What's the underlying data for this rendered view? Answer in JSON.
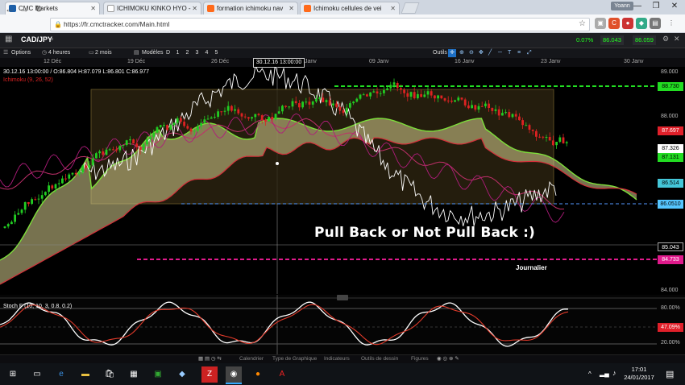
{
  "browser": {
    "tabs": [
      {
        "title": "CMC Markets",
        "color": "#1d5fa8"
      },
      {
        "title": "ICHIMOKU KINKO HYO - ",
        "color": "#888888"
      },
      {
        "title": "formation ichimoku nav",
        "color": "#ff6a1a"
      },
      {
        "title": "Ichimoku cellules de vei",
        "color": "#ff6a1a"
      }
    ],
    "user": "Yoann",
    "url": "https://fr.cmctracker.com/Main.html",
    "window_buttons": [
      "—",
      "❐",
      "✕"
    ]
  },
  "app": {
    "symbol": "CAD/JPY",
    "change": "0.07%",
    "sell": "86.043",
    "buy": "86.059",
    "toolbar": {
      "options": "Options",
      "interval": "4 heures",
      "range": "2 mois",
      "models": "Modèles",
      "periods": [
        "D",
        "1",
        "2",
        "3",
        "4",
        "5"
      ],
      "tools_label": "Outils"
    },
    "dates": [
      "12 Déc",
      "19 Déc",
      "26 Déc",
      "Janv",
      "09 Janv",
      "16 Janv",
      "23 Janv",
      "30 Janv"
    ],
    "cursor_date": "30.12.16 13:00:00",
    "ohlc": "30.12.16 13:00:00 / O:86.804  H:87.079  L:86.801  C:86.977",
    "indicator_legend": "Ichimoku (9, 26, 52)",
    "headline": "Pull Back or Not Pull Back :)",
    "timeframe_note": "Journalier",
    "price_labels": [
      {
        "value": "88.730",
        "bg": "#22dd22",
        "fg": "#000000"
      },
      {
        "value": "87.697",
        "bg": "#e0202a",
        "fg": "#ffffff"
      },
      {
        "value": "87.326",
        "bg": "#ffffff",
        "fg": "#000000"
      },
      {
        "value": "87.131",
        "bg": "#22dd22",
        "fg": "#000000"
      },
      {
        "value": "86.514",
        "bg": "#44c6d8",
        "fg": "#000000"
      },
      {
        "value": "86.0510",
        "bg": "#55c5ff",
        "fg": "#000000"
      },
      {
        "value": "85.043",
        "bg": "#000000",
        "fg": "#ffffff"
      },
      {
        "value": "84.733",
        "bg": "#e01a8c",
        "fg": "#ffffff"
      }
    ],
    "axis_labels": [
      "89.000",
      "88.000",
      "84.000"
    ],
    "stoch": {
      "legend": "Stoch F (10, 10, 3, 0.8, 0.2)",
      "levels": [
        "80.00%",
        "20.00%"
      ],
      "current": "47.09%"
    },
    "bottom_tabs": [
      "Calendrier",
      "Type de Graphique",
      "Indicateurs",
      "Outils de dessin",
      "Figures"
    ]
  },
  "taskbar": {
    "time": "17:01",
    "date": "24/01/2017"
  }
}
